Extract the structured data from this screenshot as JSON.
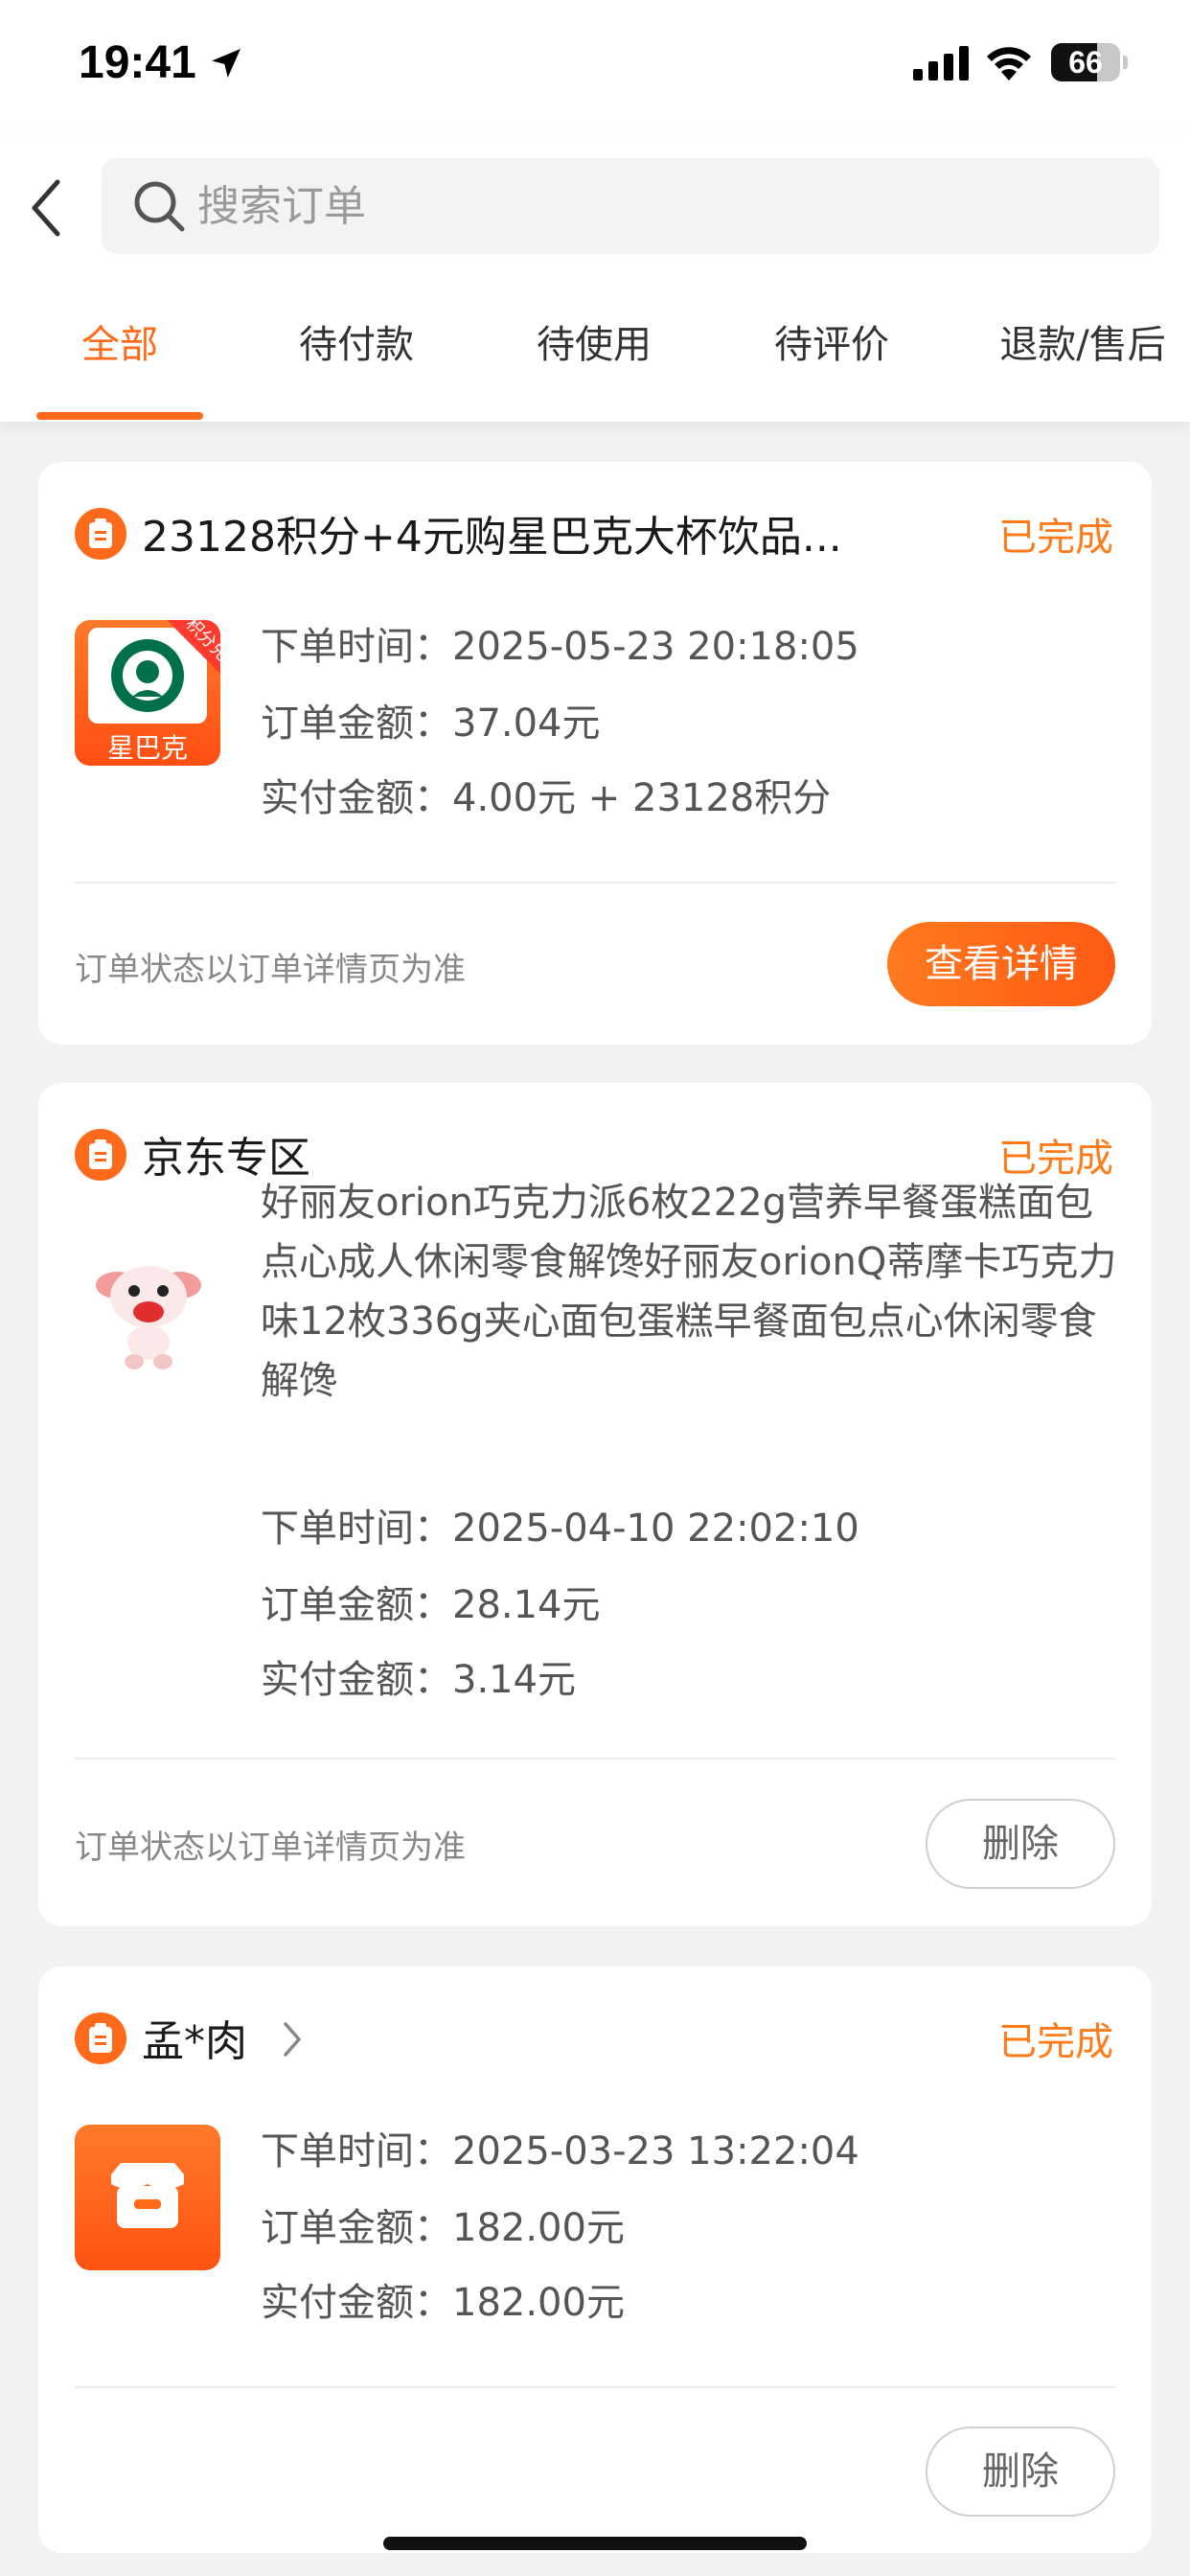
{
  "status_bar": {
    "time": "19:41",
    "battery_level": 66,
    "battery_text": "66"
  },
  "header": {
    "search_placeholder": "搜索订单",
    "tabs": [
      {
        "label": "全部",
        "active": true
      },
      {
        "label": "待付款",
        "active": false
      },
      {
        "label": "待使用",
        "active": false
      },
      {
        "label": "待评价",
        "active": false
      },
      {
        "label": "退款/售后",
        "active": false
      }
    ]
  },
  "orders": [
    {
      "store": "23128积分+4元购星巴克大杯饮品...",
      "status": "已完成",
      "thumb_caption": "星巴克",
      "thumb_badge": "积分兑",
      "order_time": "下单时间：2025-05-23 20:18:05",
      "order_amount": "订单金额：37.04元",
      "paid_amount": "实付金额：4.00元 + 23128积分",
      "note": "订单状态以订单详情页为准",
      "action": "查看详情"
    },
    {
      "store": "京东专区",
      "status": "已完成",
      "description": "好丽友orion巧克力派6枚222g营养早餐蛋糕面包点心成人休闲零食解馋好丽友orionQ蒂摩卡巧克力味12枚336g夹心面包蛋糕早餐面包点心休闲零食解馋",
      "order_time": "下单时间：2025-04-10 22:02:10",
      "order_amount": "订单金额：28.14元",
      "paid_amount": "实付金额：3.14元",
      "note": "订单状态以订单详情页为准",
      "action": "删除"
    },
    {
      "store": "孟*肉",
      "status": "已完成",
      "order_time": "下单时间：2025-03-23 13:22:04",
      "order_amount": "订单金额：182.00元",
      "paid_amount": "实付金额：182.00元",
      "action": "删除"
    }
  ],
  "colors": {
    "accent": "#ff6a1a",
    "status": "#ff7b1a",
    "starbucks_green": "#00704a"
  },
  "icons": [
    "location-arrow-icon",
    "signal-icon",
    "wifi-icon",
    "battery-icon",
    "back-icon",
    "search-icon",
    "order-icon",
    "chevron-right-icon",
    "storefront-icon"
  ]
}
